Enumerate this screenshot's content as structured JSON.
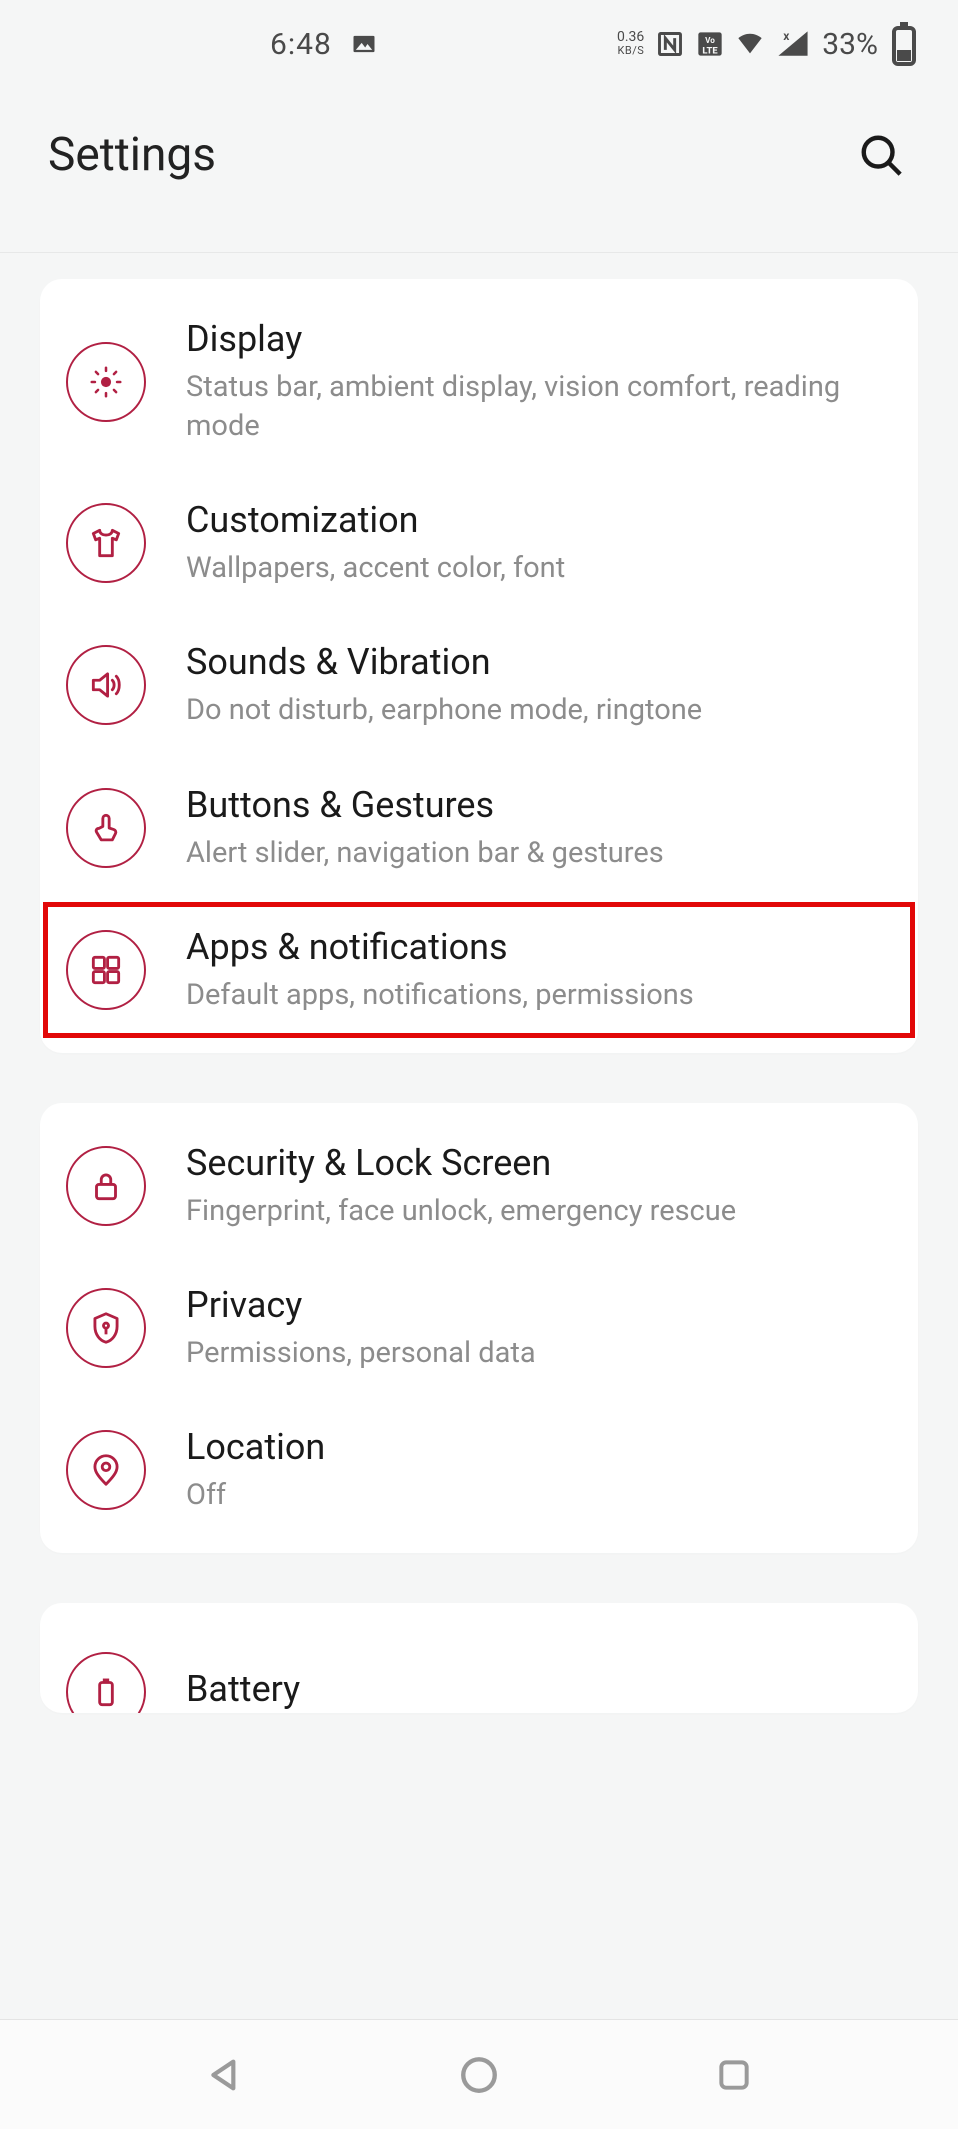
{
  "status_bar": {
    "time": "6:48",
    "data_rate_value": "0.36",
    "data_rate_unit": "KB/S",
    "battery_percent": "33%"
  },
  "header": {
    "title": "Settings"
  },
  "groups": [
    {
      "items": [
        {
          "id": "display",
          "icon": "sun-icon",
          "title": "Display",
          "subtitle": "Status bar, ambient display, vision comfort, reading mode",
          "highlight": false
        },
        {
          "id": "customization",
          "icon": "shirt-icon",
          "title": "Customization",
          "subtitle": "Wallpapers, accent color, font",
          "highlight": false
        },
        {
          "id": "sounds",
          "icon": "speaker-icon",
          "title": "Sounds & Vibration",
          "subtitle": "Do not disturb, earphone mode, ringtone",
          "highlight": false
        },
        {
          "id": "buttons",
          "icon": "touch-icon",
          "title": "Buttons & Gestures",
          "subtitle": "Alert slider, navigation bar & gestures",
          "highlight": false
        },
        {
          "id": "apps",
          "icon": "grid-icon",
          "title": "Apps & notifications",
          "subtitle": "Default apps, notifications, permissions",
          "highlight": true
        }
      ]
    },
    {
      "items": [
        {
          "id": "security",
          "icon": "lock-icon",
          "title": "Security & Lock Screen",
          "subtitle": "Fingerprint, face unlock, emergency rescue",
          "highlight": false
        },
        {
          "id": "privacy",
          "icon": "shield-key-icon",
          "title": "Privacy",
          "subtitle": "Permissions, personal data",
          "highlight": false
        },
        {
          "id": "location",
          "icon": "pin-icon",
          "title": "Location",
          "subtitle": "Off",
          "highlight": false
        }
      ]
    },
    {
      "items": [
        {
          "id": "battery",
          "icon": "battery-icon",
          "title": "Battery",
          "subtitle": "",
          "highlight": false
        }
      ]
    }
  ],
  "accent": "#b12043",
  "highlight_box": "#e20808"
}
